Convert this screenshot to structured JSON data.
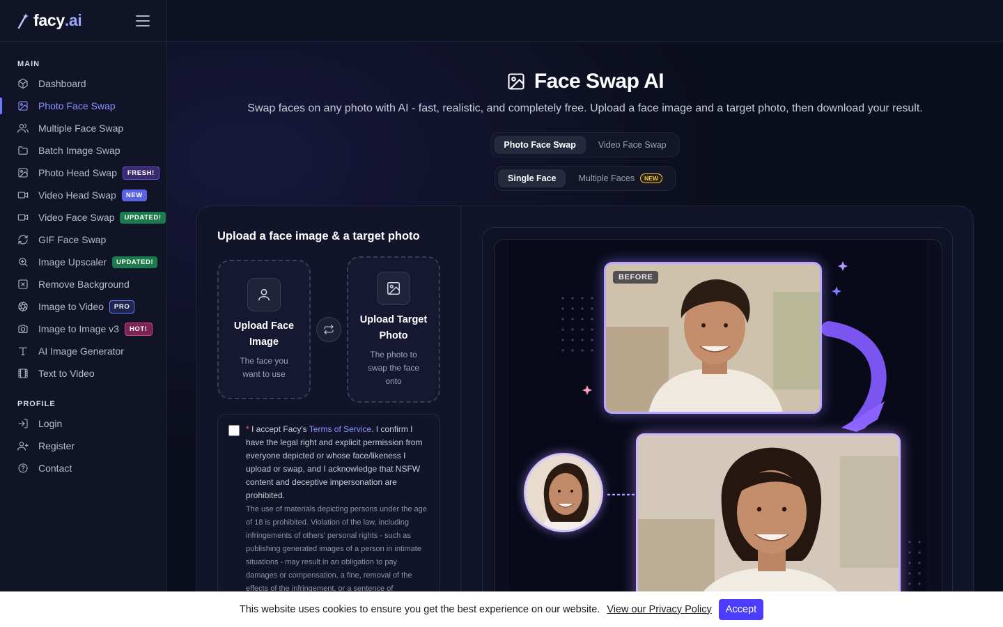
{
  "brand": {
    "name": "facy",
    "suffix": ".ai"
  },
  "sidebar": {
    "main_title": "MAIN",
    "items": [
      {
        "label": "Dashboard",
        "icon": "cube-icon"
      },
      {
        "label": "Photo Face Swap",
        "icon": "image-icon",
        "active": true
      },
      {
        "label": "Multiple Face Swap",
        "icon": "users-icon"
      },
      {
        "label": "Batch Image Swap",
        "icon": "folder-icon"
      },
      {
        "label": "Photo Head Swap",
        "icon": "image-icon",
        "badge": "FRESH!"
      },
      {
        "label": "Video Head Swap",
        "icon": "video-icon",
        "badge": "NEW"
      },
      {
        "label": "Video Face Swap",
        "icon": "video-icon",
        "badge": "UPDATED!"
      },
      {
        "label": "GIF Face Swap",
        "icon": "refresh-icon"
      },
      {
        "label": "Image Upscaler",
        "icon": "zoom-icon",
        "badge": "UPDATED!"
      },
      {
        "label": "Remove Background",
        "icon": "remove-bg-icon"
      },
      {
        "label": "Image to Video",
        "icon": "aperture-icon",
        "badge": "PRO"
      },
      {
        "label": "Image to Image v3",
        "icon": "camera-icon",
        "badge": "HOT!"
      },
      {
        "label": "AI Image Generator",
        "icon": "text-icon"
      },
      {
        "label": "Text to Video",
        "icon": "film-icon"
      }
    ],
    "profile_title": "PROFILE",
    "profile_items": [
      {
        "label": "Login",
        "icon": "login-icon"
      },
      {
        "label": "Register",
        "icon": "user-plus-icon"
      },
      {
        "label": "Contact",
        "icon": "help-icon"
      }
    ]
  },
  "hero": {
    "title": "Face Swap AI",
    "subtitle": "Swap faces on any photo with AI - fast, realistic, and completely free. Upload a face image and a target photo, then download your result."
  },
  "mode_tabs": {
    "photo": "Photo Face Swap",
    "video": "Video Face Swap",
    "selected": "Photo Face Swap"
  },
  "face_tabs": {
    "single": "Single Face",
    "multiple": "Multiple Faces",
    "multiple_badge": "NEW",
    "selected": "Single Face"
  },
  "upload": {
    "title": "Upload a face image & a target photo",
    "face_title": "Upload Face Image",
    "face_desc": "The face you want to use",
    "target_title": "Upload Target Photo",
    "target_desc": "The photo to swap the face onto"
  },
  "terms": {
    "required_mark": "*",
    "text_before": " I accept Facy's ",
    "link": "Terms of Service",
    "text_after": ". I confirm I have the legal right and explicit permission from everyone depicted or whose face/likeness I upload or swap, and I acknowledge that NSFW content and deceptive impersonation are prohibited.",
    "small": "The use of materials depicting persons under the age of 18 is prohibited. Violation of the law, including infringements of others' personal rights - such as publishing generated images of a person in intimate situations - may result in an obligation to pay damages or compensation, a fine, removal of the effects of the infringement, or a sentence of"
  },
  "preview": {
    "before_label": "BEFORE"
  },
  "cookie": {
    "text": "This website uses cookies to ensure you get the best experience on our website.",
    "link": "View our Privacy Policy",
    "button": "Accept"
  },
  "colors": {
    "accent": "#6f7bff",
    "cookie_button": "#4b3cff",
    "background": "#0b0e1c"
  }
}
